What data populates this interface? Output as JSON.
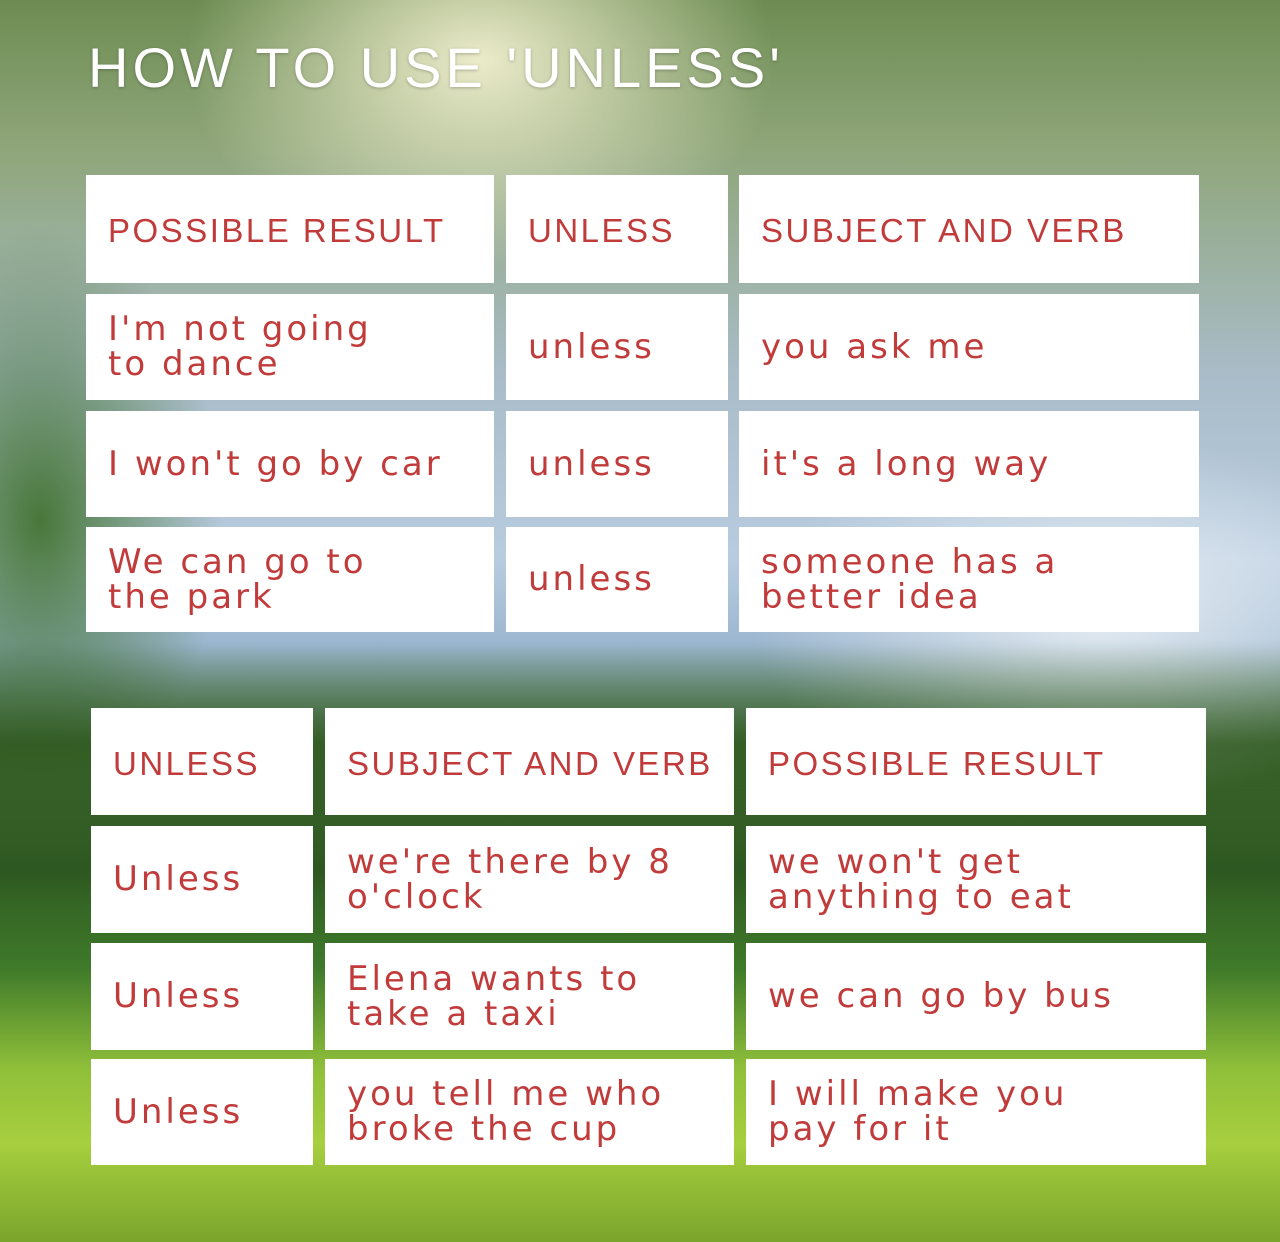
{
  "title": "HOW TO USE 'UNLESS'",
  "colors": {
    "text": "#c13b3b",
    "cell_background": "#ffffff",
    "title": "#ffffff"
  },
  "table1": {
    "headers": [
      "POSSIBLE RESULT",
      "UNLESS",
      "SUBJECT AND VERB"
    ],
    "rows": [
      [
        "I'm not going to dance",
        "unless",
        "you ask me"
      ],
      [
        "I won't go by car",
        "unless",
        "it's a long way"
      ],
      [
        "We can go to the park",
        "unless",
        "someone has a better idea"
      ]
    ]
  },
  "table2": {
    "headers": [
      "UNLESS",
      "SUBJECT AND VERB",
      "POSSIBLE RESULT"
    ],
    "rows": [
      [
        "Unless",
        "we're there by 8 o'clock",
        "we won't get anything to eat"
      ],
      [
        "Unless",
        "Elena wants to take a taxi",
        "we can go by bus"
      ],
      [
        "Unless",
        "you tell me who broke the cup",
        "I will make you pay for it"
      ]
    ]
  }
}
